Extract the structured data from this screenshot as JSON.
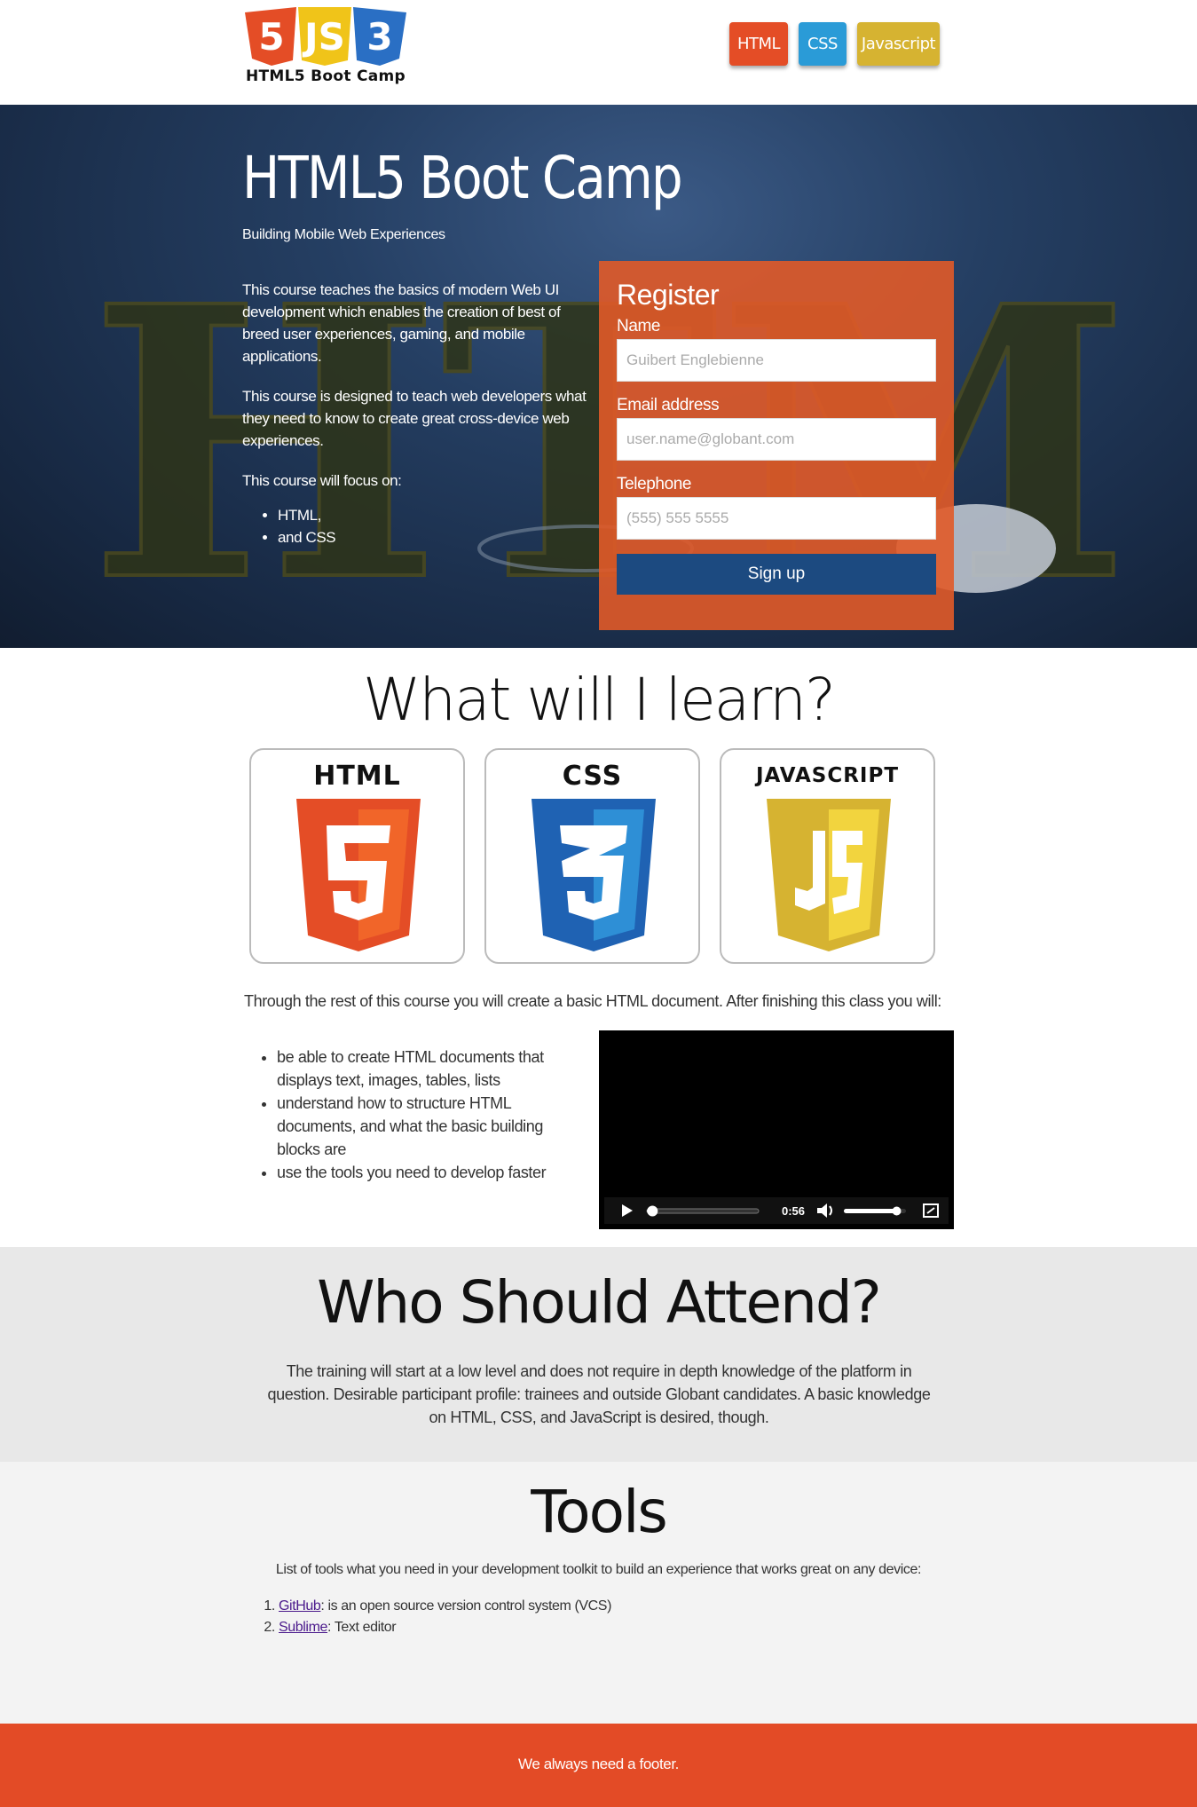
{
  "header": {
    "logo_text": "HTML5 Boot Camp",
    "nav": [
      "HTML",
      "CSS",
      "Javascript"
    ]
  },
  "hero": {
    "title": "HTML5 Boot Camp",
    "subtitle": "Building Mobile Web Experiences",
    "p1": "This course teaches the basics of modern Web UI development which enables the creation of best of breed user experiences, gaming, and mobile applications.",
    "p2": "This course is designed to teach web developers what they need to know to create great cross-device web experiences.",
    "p3": "This course will focus on:",
    "focus": [
      "HTML,",
      "and CSS"
    ]
  },
  "register": {
    "title": "Register",
    "name_label": "Name",
    "name_placeholder": "Guibert Englebienne",
    "email_label": "Email address",
    "email_placeholder": "user.name@globant.com",
    "phone_label": "Telephone",
    "phone_placeholder": "(555) 555 5555",
    "submit": "Sign up"
  },
  "learn": {
    "title": "What will I learn?",
    "cards": [
      "HTML",
      "CSS",
      "JAVASCRIPT"
    ],
    "intro": "Through the rest of this course you will create a basic HTML document. After finishing this class you will:",
    "items": [
      "be able to create HTML documents that displays text, images, tables, lists",
      "understand how to structure HTML documents, and what the basic building blocks are",
      "use the tools you need to develop faster"
    ],
    "video_time": "0:56",
    "video_progress": 0.05,
    "video_volume": 0.85
  },
  "attend": {
    "title": "Who Should Attend?",
    "text": "The training will start at a low level and does not require in depth knowledge of the platform in question. Desirable participant profile: trainees and outside Globant candidates. A basic knowledge on HTML, CSS, and JavaScript is desired, though."
  },
  "tools": {
    "title": "Tools",
    "intro": "List of tools what you need in your development toolkit to build an experience that works great on any device:",
    "items": [
      {
        "name": "GitHub",
        "desc": ": is an open source version control system (VCS)"
      },
      {
        "name": "Sublime",
        "desc": ": Text editor"
      }
    ]
  },
  "footer": {
    "text": "We always need a footer."
  },
  "colors": {
    "html": "#e44d26",
    "css": "#2a9bd7",
    "js": "#d6b331",
    "signup": "#1c4a80",
    "footer": "#e34b26"
  }
}
